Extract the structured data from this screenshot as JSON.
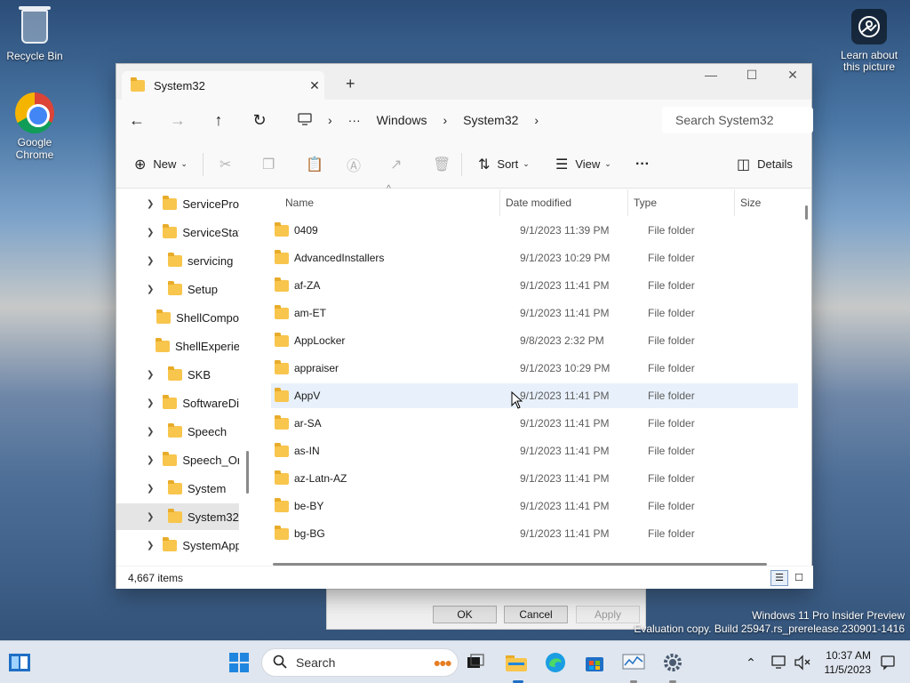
{
  "desktop": {
    "icons": [
      {
        "label": "Recycle Bin",
        "icon": "recycle-bin-icon"
      },
      {
        "label": "Google Chrome",
        "icon": "chrome-icon"
      }
    ],
    "learn_label": "Learn about this picture"
  },
  "window": {
    "tab_title": "System32",
    "new_tab": "+",
    "address": {
      "crumbs": [
        "Windows",
        "System32"
      ],
      "overflow": "···"
    },
    "search_placeholder": "Search System32",
    "commands": {
      "new": "New",
      "sort": "Sort",
      "view": "View",
      "more": "···",
      "details": "Details"
    },
    "tree": [
      {
        "label": "ServiceProf",
        "expandable": true,
        "selected": false
      },
      {
        "label": "ServiceState",
        "expandable": true,
        "selected": false
      },
      {
        "label": "servicing",
        "expandable": true,
        "selected": false
      },
      {
        "label": "Setup",
        "expandable": true,
        "selected": false
      },
      {
        "label": "ShellCompo",
        "expandable": false,
        "selected": false
      },
      {
        "label": "ShellExperie",
        "expandable": false,
        "selected": false
      },
      {
        "label": "SKB",
        "expandable": true,
        "selected": false
      },
      {
        "label": "SoftwareDis",
        "expandable": true,
        "selected": false
      },
      {
        "label": "Speech",
        "expandable": true,
        "selected": false
      },
      {
        "label": "Speech_On",
        "expandable": true,
        "selected": false
      },
      {
        "label": "System",
        "expandable": true,
        "selected": false
      },
      {
        "label": "System32",
        "expandable": true,
        "selected": true
      },
      {
        "label": "SystemApp",
        "expandable": true,
        "selected": false
      }
    ],
    "columns": [
      "Name",
      "Date modified",
      "Type",
      "Size"
    ],
    "rows": [
      {
        "name": "0409",
        "date": "9/1/2023 11:39 PM",
        "type": "File folder"
      },
      {
        "name": "AdvancedInstallers",
        "date": "9/1/2023 10:29 PM",
        "type": "File folder"
      },
      {
        "name": "af-ZA",
        "date": "9/1/2023 11:41 PM",
        "type": "File folder"
      },
      {
        "name": "am-ET",
        "date": "9/1/2023 11:41 PM",
        "type": "File folder"
      },
      {
        "name": "AppLocker",
        "date": "9/8/2023 2:32 PM",
        "type": "File folder"
      },
      {
        "name": "appraiser",
        "date": "9/1/2023 10:29 PM",
        "type": "File folder"
      },
      {
        "name": "AppV",
        "date": "9/1/2023 11:41 PM",
        "type": "File folder"
      },
      {
        "name": "ar-SA",
        "date": "9/1/2023 11:41 PM",
        "type": "File folder"
      },
      {
        "name": "as-IN",
        "date": "9/1/2023 11:41 PM",
        "type": "File folder"
      },
      {
        "name": "az-Latn-AZ",
        "date": "9/1/2023 11:41 PM",
        "type": "File folder"
      },
      {
        "name": "be-BY",
        "date": "9/1/2023 11:41 PM",
        "type": "File folder"
      },
      {
        "name": "bg-BG",
        "date": "9/1/2023 11:41 PM",
        "type": "File folder"
      }
    ],
    "status": "4,667 items"
  },
  "dialog": {
    "ok": "OK",
    "cancel": "Cancel",
    "apply": "Apply"
  },
  "watermark": {
    "line1": "Windows 11 Pro Insider Preview",
    "line2": "Evaluation copy. Build 25947.rs_prerelease.230901-1416"
  },
  "taskbar": {
    "search": "Search",
    "time": "10:37 AM",
    "date": "11/5/2023"
  },
  "colors": {
    "folder": "#f8c54d",
    "hover_row": "#e8f1fb",
    "selected_tree": "#e5e5e5",
    "taskbar": "#dfe6ef"
  }
}
